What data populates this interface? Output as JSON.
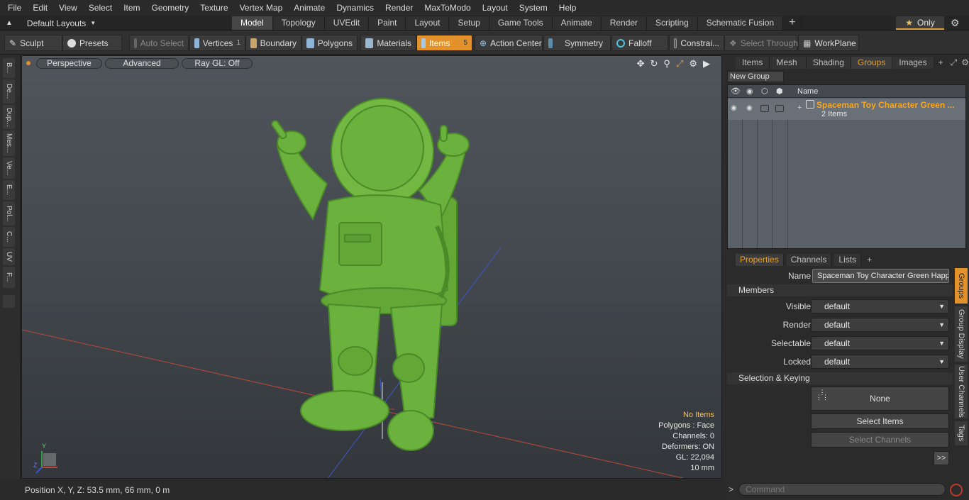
{
  "menu": [
    "File",
    "Edit",
    "View",
    "Select",
    "Item",
    "Geometry",
    "Texture",
    "Vertex Map",
    "Animate",
    "Dynamics",
    "Render",
    "MaxToModo",
    "Layout",
    "System",
    "Help"
  ],
  "layout": {
    "dropdown_label": "Default Layouts",
    "tabs": [
      "Model",
      "Topology",
      "UVEdit",
      "Paint",
      "Layout",
      "Setup",
      "Game Tools",
      "Animate",
      "Render",
      "Scripting",
      "Schematic Fusion"
    ],
    "add_tab": "+",
    "only_label": "Only"
  },
  "toolbar": {
    "sculpt": "Sculpt",
    "presets": "Presets",
    "auto_select": "Auto Select",
    "vertices": "Vertices",
    "vertices_count": "1",
    "boundary": "Boundary",
    "polygons": "Polygons",
    "materials": "Materials",
    "items": "Items",
    "items_count": "5",
    "action_center": "Action Center",
    "symmetry": "Symmetry",
    "falloff": "Falloff",
    "constraints": "Constrai...",
    "select_through": "Select Through",
    "workplane": "WorkPlane"
  },
  "left_tabs": [
    "B...",
    "De...",
    "Dup...",
    "Mes...",
    "Ve...",
    "E...",
    "Pol...",
    "C...",
    "UV",
    "F..."
  ],
  "viewport": {
    "view_mode": "Perspective",
    "shading": "Advanced",
    "raygl": "Ray GL: Off",
    "stats": {
      "selection": "No Items",
      "polygons": "Polygons : Face",
      "channels": "Channels: 0",
      "deformers": "Deformers: ON",
      "gl": "GL: 22,094",
      "grid": "10 mm"
    },
    "axis_z": "Z",
    "axis_y": "Y"
  },
  "status": {
    "position": "Position X, Y, Z:   53.5 mm, 66 mm, 0 m"
  },
  "groups_panel": {
    "tabs": [
      "Items",
      "Mesh ...",
      "Shading",
      "Groups",
      "Images"
    ],
    "active_tab": "Groups",
    "add_tab": "+",
    "new_group": "New Group",
    "column_name": "Name",
    "group_name": "Spaceman Toy Character Green ...",
    "group_count": "2 Items"
  },
  "properties": {
    "tabs": [
      "Properties",
      "Channels",
      "Lists"
    ],
    "add_tab": "+",
    "name_label": "Name",
    "name_value": "Spaceman Toy Character Green Happ",
    "members_section": "Members",
    "visible_label": "Visible",
    "visible_value": "default",
    "render_label": "Render",
    "render_value": "default",
    "selectable_label": "Selectable",
    "selectable_value": "default",
    "locked_label": "Locked",
    "locked_value": "default",
    "keying_section": "Selection & Keying",
    "none_label": "None",
    "select_items": "Select Items",
    "select_channels": "Select Channels",
    "more": ">>",
    "side_tabs": [
      "Groups",
      "Group Display",
      "User Channels",
      "Tags"
    ]
  },
  "command": {
    "prompt": ">",
    "placeholder": "Command"
  },
  "colors": {
    "accent": "#e3912a",
    "group_name": "#f5a623",
    "model_green": "#6bb13d"
  }
}
